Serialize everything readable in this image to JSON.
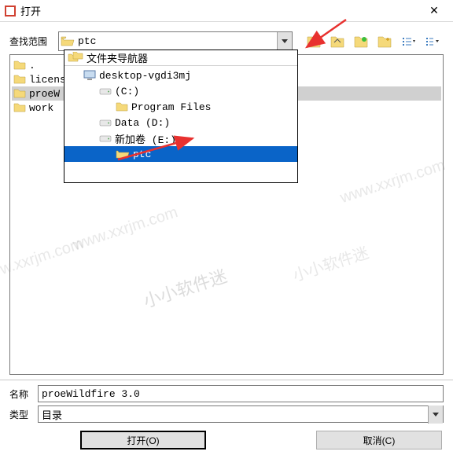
{
  "titlebar": {
    "title": "打开"
  },
  "lookin": {
    "label": "查找范围",
    "value": "ptc"
  },
  "filelist": [
    {
      "name": ".",
      "selected": false
    },
    {
      "name": "license",
      "selected": false
    },
    {
      "name": "proeW",
      "selected": true
    },
    {
      "name": "work",
      "selected": false
    }
  ],
  "navigator": {
    "header": "文件夹导航器",
    "items": [
      {
        "text": "desktop-vgdi3mj",
        "icon": "computer",
        "indent": 1,
        "selected": false
      },
      {
        "text": "(C:)",
        "icon": "drive",
        "indent": 2,
        "selected": false
      },
      {
        "text": "Program Files",
        "icon": "folder",
        "indent": 3,
        "selected": false
      },
      {
        "text": "Data (D:)",
        "icon": "drive",
        "indent": 2,
        "selected": false
      },
      {
        "text": "新加卷 (E:)",
        "icon": "drive",
        "indent": 2,
        "selected": false
      },
      {
        "text": "ptc",
        "icon": "folder-open",
        "indent": 3,
        "selected": true
      }
    ]
  },
  "name_field": {
    "label": "名称",
    "value": "proeWildfire 3.0"
  },
  "type_field": {
    "label": "类型",
    "value": "目录"
  },
  "buttons": {
    "open": "打开(O)",
    "cancel": "取消(C)"
  },
  "watermark": {
    "cn": "小小软件迷",
    "en": "www.xxrjm.com"
  }
}
